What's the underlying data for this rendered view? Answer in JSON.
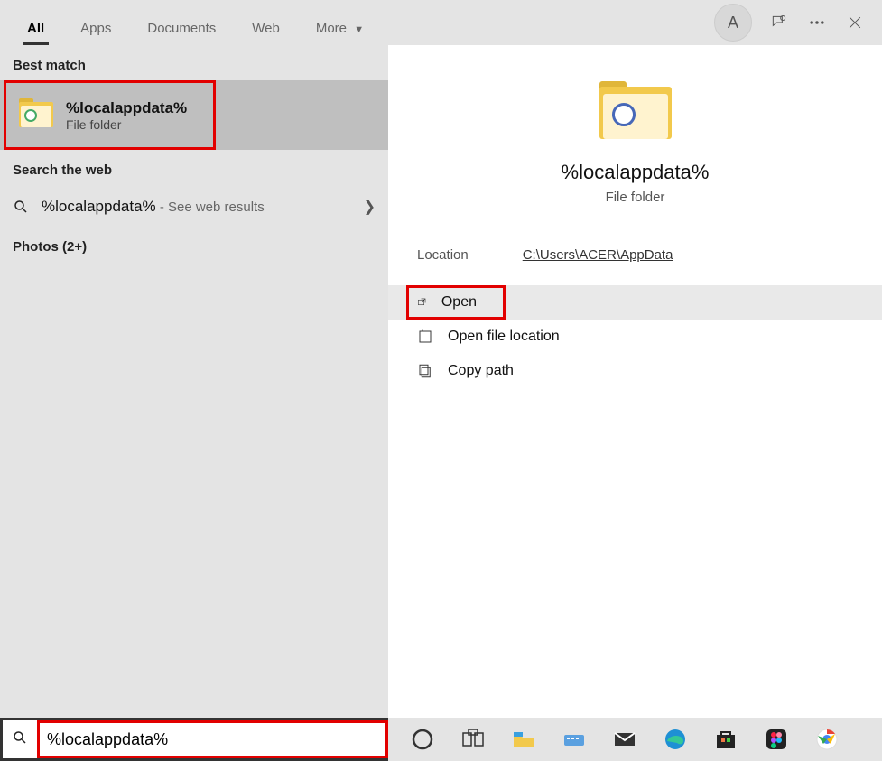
{
  "tabs": {
    "all": "All",
    "apps": "Apps",
    "documents": "Documents",
    "web": "Web",
    "more": "More"
  },
  "avatar_letter": "A",
  "left": {
    "best_match_label": "Best match",
    "best_match": {
      "title": "%localappdata%",
      "subtitle": "File folder"
    },
    "search_web_label": "Search the web",
    "web_result": {
      "query": "%localappdata%",
      "hint": " - See web results"
    },
    "photos_label": "Photos (2+)"
  },
  "right": {
    "title": "%localappdata%",
    "subtitle": "File folder",
    "location_label": "Location",
    "location_value": "C:\\Users\\ACER\\AppData",
    "actions": {
      "open": "Open",
      "open_loc": "Open file location",
      "copy_path": "Copy path"
    }
  },
  "search_value": "%localappdata%"
}
